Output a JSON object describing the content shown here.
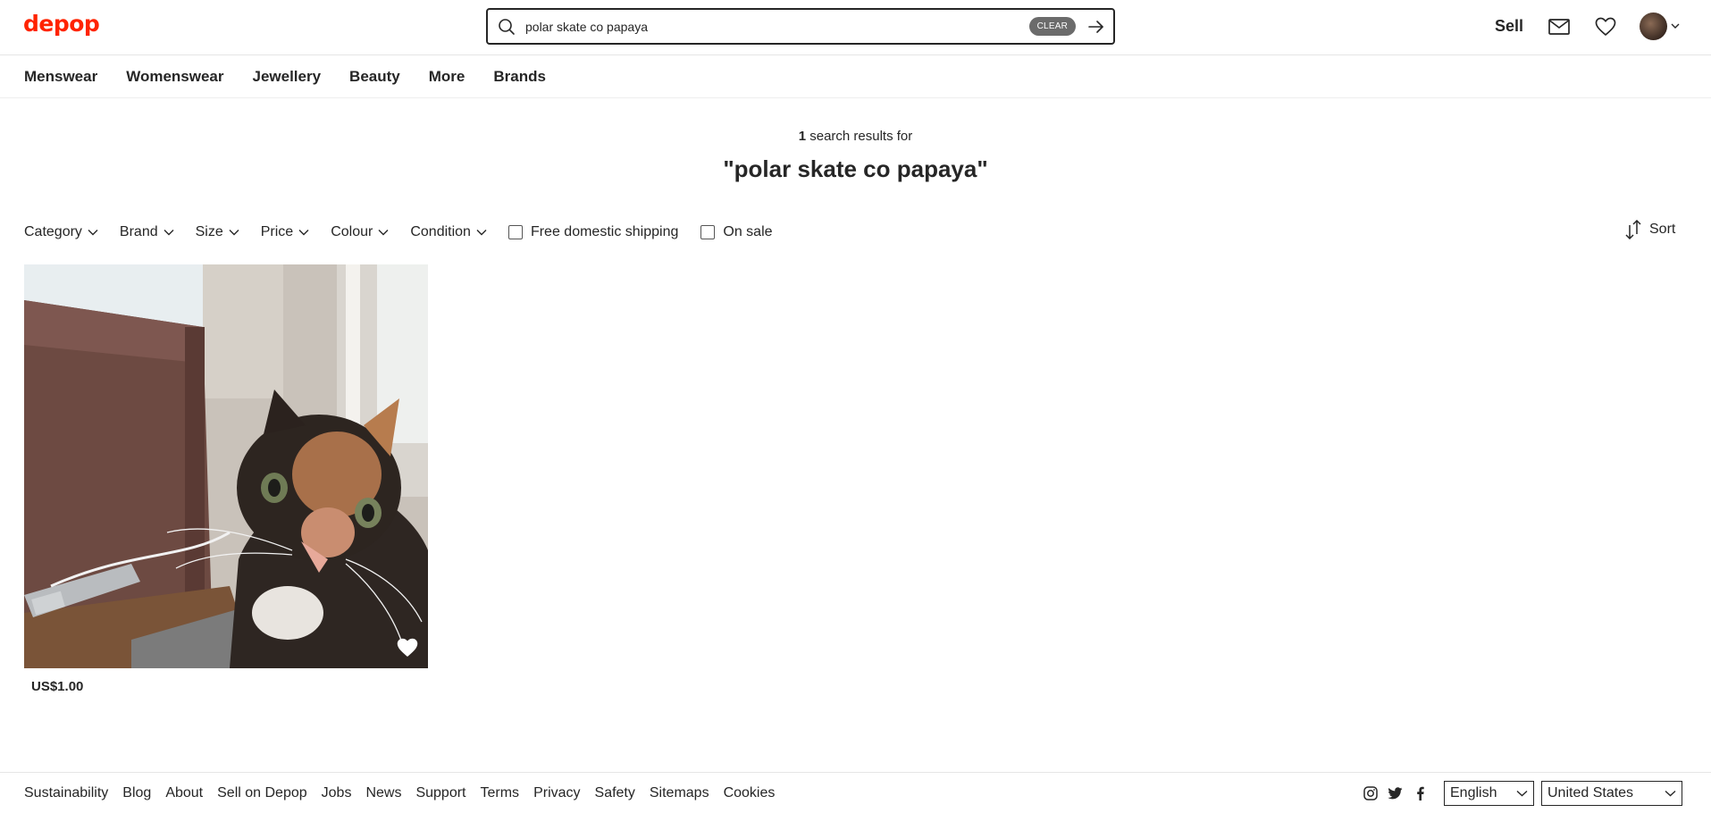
{
  "brand": {
    "logo": "depop",
    "accent_color": "#ff2300"
  },
  "search": {
    "value": "polar skate co papaya",
    "clear_label": "CLEAR"
  },
  "header": {
    "sell_label": "Sell",
    "icons": [
      "mail-icon",
      "heart-icon",
      "avatar"
    ]
  },
  "nav": {
    "categories": [
      "Menswear",
      "Womenswear",
      "Jewellery",
      "Beauty",
      "More",
      "Brands"
    ]
  },
  "results": {
    "count": "1",
    "count_suffix": " search results for",
    "query": "\"polar skate co papaya\""
  },
  "filters": {
    "dropdowns": [
      "Category",
      "Brand",
      "Size",
      "Price",
      "Colour",
      "Condition"
    ],
    "checkboxes": [
      "Free domestic shipping",
      "On sale"
    ],
    "sort_label": "Sort"
  },
  "products": [
    {
      "price": "US$1.00",
      "liked": false
    }
  ],
  "footer": {
    "links": [
      "Sustainability",
      "Blog",
      "About",
      "Sell on Depop",
      "Jobs",
      "News",
      "Support",
      "Terms",
      "Privacy",
      "Safety",
      "Sitemaps",
      "Cookies"
    ],
    "social": [
      "instagram-icon",
      "twitter-icon",
      "facebook-icon"
    ],
    "language": "English",
    "country": "United States"
  }
}
